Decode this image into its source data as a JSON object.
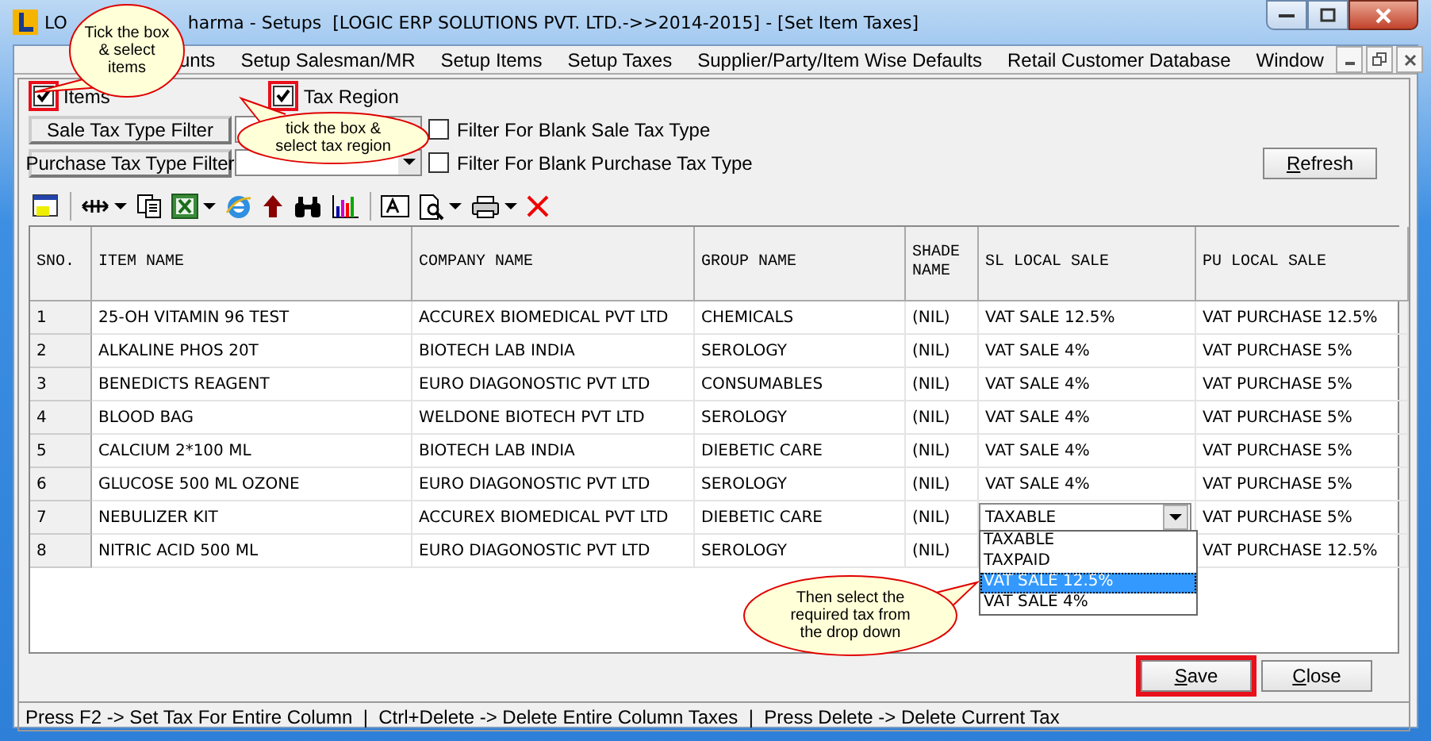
{
  "window": {
    "title_start": "LO",
    "title_rest": "harma - Setups  [LOGIC ERP SOLUTIONS PVT. LTD.->>2014-2015] - [Set Item Taxes]"
  },
  "menu": [
    "unts",
    "Setup Salesman/MR",
    "Setup Items",
    "Setup Taxes",
    "Supplier/Party/Item Wise Defaults",
    "Retail Customer Database",
    "Window"
  ],
  "options": [
    {
      "label": "Items",
      "checked": true,
      "highlighted": true
    },
    {
      "label": "Tax Region",
      "checked": true,
      "highlighted": true
    }
  ],
  "filters": [
    {
      "label": "Sale Tax Type Filter",
      "blank_label": "Filter For Blank Sale Tax Type",
      "blank_checked": false
    },
    {
      "label": "Purchase Tax Type Filter",
      "blank_label": "Filter For Blank Purchase Tax Type",
      "blank_checked": false
    }
  ],
  "refresh_button": "Refresh",
  "table": {
    "columns": [
      "SNO.",
      "ITEM NAME",
      "COMPANY NAME",
      "GROUP NAME",
      "SHADE NAME",
      "SL LOCAL SALE",
      "PU LOCAL SALE"
    ],
    "rows": [
      {
        "sno": "1",
        "item": "25-OH VITAMIN 96 TEST",
        "company": "ACCUREX BIOMEDICAL PVT LTD",
        "group": "CHEMICALS",
        "shade": "(NIL)",
        "sl": "VAT SALE 12.5%",
        "pu": "VAT PURCHASE 12.5%"
      },
      {
        "sno": "2",
        "item": "ALKALINE PHOS 20T",
        "company": "BIOTECH LAB INDIA",
        "group": "SEROLOGY",
        "shade": "(NIL)",
        "sl": "VAT SALE 4%",
        "pu": "VAT PURCHASE 5%"
      },
      {
        "sno": "3",
        "item": "BENEDICTS REAGENT",
        "company": "EURO DIAGONOSTIC PVT LTD",
        "group": "CONSUMABLES",
        "shade": "(NIL)",
        "sl": "VAT SALE 4%",
        "pu": "VAT PURCHASE 5%"
      },
      {
        "sno": "4",
        "item": "BLOOD BAG",
        "company": "WELDONE BIOTECH PVT LTD",
        "group": "SEROLOGY",
        "shade": "(NIL)",
        "sl": "VAT SALE 4%",
        "pu": "VAT PURCHASE 5%"
      },
      {
        "sno": "5",
        "item": "CALCIUM 2*100 ML",
        "company": "BIOTECH LAB INDIA",
        "group": "DIEBETIC CARE",
        "shade": "(NIL)",
        "sl": "VAT SALE 4%",
        "pu": "VAT PURCHASE 5%"
      },
      {
        "sno": "6",
        "item": "GLUCOSE 500 ML OZONE",
        "company": "EURO DIAGONOSTIC PVT LTD",
        "group": "SEROLOGY",
        "shade": "(NIL)",
        "sl": "VAT SALE 4%",
        "pu": "VAT PURCHASE 5%"
      },
      {
        "sno": "7",
        "item": "NEBULIZER KIT",
        "company": "ACCUREX BIOMEDICAL PVT LTD",
        "group": "DIEBETIC CARE",
        "shade": "(NIL)",
        "sl_editor": "TAXABLE",
        "pu": "VAT PURCHASE 5%"
      },
      {
        "sno": "8",
        "item": "NITRIC ACID 500 ML",
        "company": "EURO DIAGONOSTIC PVT LTD",
        "group": "SEROLOGY",
        "shade": "(NIL)",
        "pu": "VAT PURCHASE 12.5%"
      }
    ]
  },
  "dropdown": [
    {
      "label": "TAXABLE",
      "selected": false
    },
    {
      "label": "TAXPAID",
      "selected": false
    },
    {
      "label": "VAT SALE 12.5%",
      "selected": true
    },
    {
      "label": "VAT SALE 4%",
      "selected": false
    }
  ],
  "buttons": [
    {
      "label": "Save",
      "highlighted": true
    },
    {
      "label": "Close",
      "highlighted": false
    }
  ],
  "status_bar": "Press F2 -> Set Tax For Entire Column  |  Ctrl+Delete -> Delete Entire Column Taxes  |  Press Delete -> Delete Current Tax",
  "callouts": [
    {
      "text": "Tick the box & select items"
    },
    {
      "text": "tick the box & select tax region"
    },
    {
      "text": "Then select the required tax from the drop down"
    }
  ]
}
